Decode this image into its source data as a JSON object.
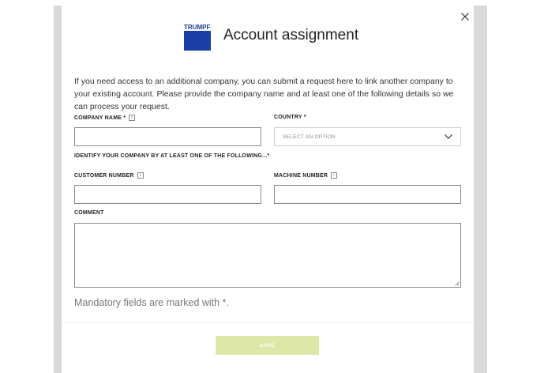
{
  "modal": {
    "title": "Account assignment",
    "logo_text": "TRUMPF",
    "intro": "If you need access to an additional company, you can submit a request here to link another company to your existing account. Please provide the company name and at least one of the following details so we can process your request.",
    "mandatory_note": "Mandatory fields are marked with *.",
    "save_label": "SAVE"
  },
  "form": {
    "company_name_label": "COMPANY NAME *",
    "country_label": "COUNTRY *",
    "country_placeholder": "SELECT AN OPTION",
    "identify_label": "IDENTIFY YOUR COMPANY BY AT LEAST ONE OF THE FOLLOWING...*",
    "customer_number_label": "CUSTOMER NUMBER",
    "machine_number_label": "MACHINE NUMBER",
    "comment_label": "COMMENT",
    "company_name_value": "",
    "customer_number_value": "",
    "machine_number_value": "",
    "comment_value": ""
  },
  "colors": {
    "brand_blue": "#1a3fa6",
    "save_disabled": "#dde7a8"
  },
  "icons": {
    "close": "close-icon",
    "info": "info-icon",
    "dropdown": "chevron-down-icon"
  }
}
